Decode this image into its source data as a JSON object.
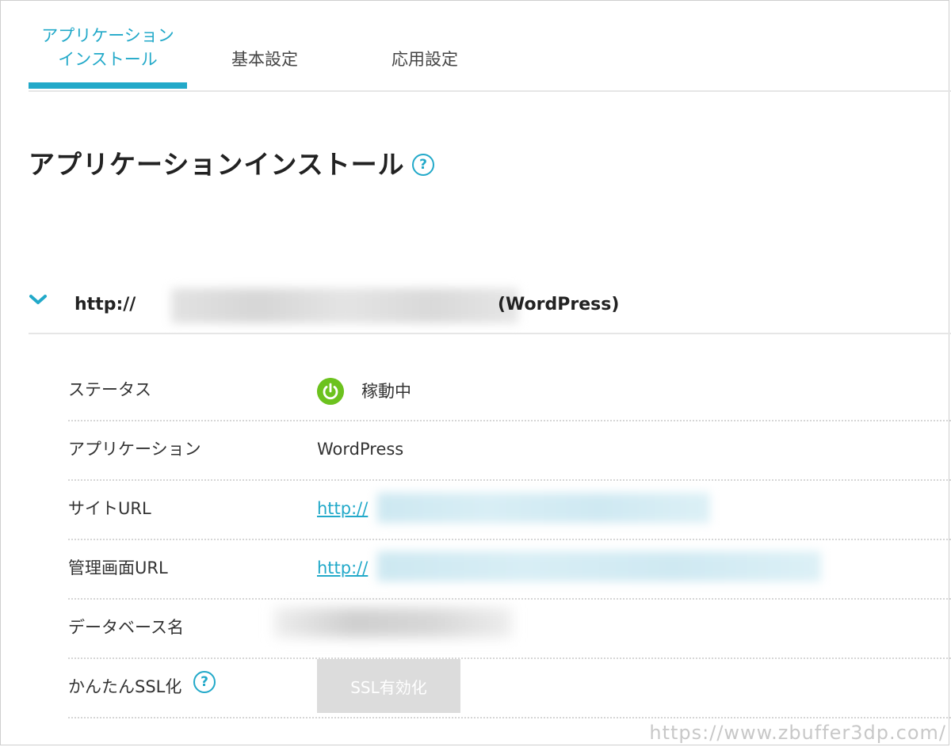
{
  "tabs": [
    {
      "label_line1": "アプリケーション",
      "label_line2": "インストール",
      "active": true
    },
    {
      "label": "基本設定",
      "active": false
    },
    {
      "label": "応用設定",
      "active": false
    }
  ],
  "page": {
    "title": "アプリケーションインストール",
    "help_icon": "question-circle-icon"
  },
  "app": {
    "url_prefix": "http://",
    "kind": "(WordPress)",
    "expand_icon": "chevron-down-icon"
  },
  "details": {
    "status": {
      "label": "ステータス",
      "value": "稼動中",
      "icon": "power-icon",
      "color": "#6cc21e"
    },
    "application": {
      "label": "アプリケーション",
      "value": "WordPress"
    },
    "site_url": {
      "label": "サイトURL",
      "value": "http://"
    },
    "admin_url": {
      "label": "管理画面URL",
      "value": "http://"
    },
    "database": {
      "label": "データベース名"
    },
    "ssl": {
      "label": "かんたんSSL化",
      "button": "SSL有効化"
    }
  },
  "watermark": "https://www.zbuffer3dp.com/",
  "colors": {
    "accent": "#22a9c9",
    "status_green": "#6cc21e",
    "button_disabled": "#dcdcdc"
  }
}
